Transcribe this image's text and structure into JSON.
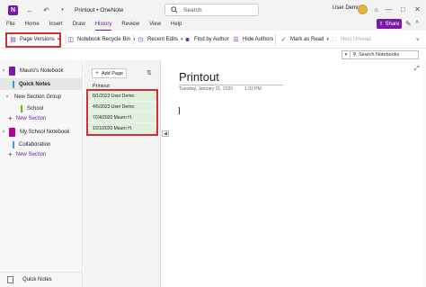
{
  "titlebar": {
    "app_icon": "N",
    "title": "Printout • OneNote",
    "search_placeholder": "Search",
    "user_name": "User Demo",
    "icons": [
      "back-icon",
      "undo-icon",
      "search-icon",
      "lightbulb-icon",
      "minimize-icon",
      "maximize-icon",
      "close-icon"
    ]
  },
  "ribbon": {
    "tabs": [
      "File",
      "Home",
      "Insert",
      "Draw",
      "History",
      "Review",
      "View",
      "Help"
    ],
    "active_tab": "History",
    "share_label": "Share",
    "commands": {
      "page_versions": "Page Versions",
      "recycle_bin": "Notebook Recycle Bin",
      "recent_edits": "Recent Edits",
      "find_by_author": "Find by Author",
      "hide_authors": "Hide Authors",
      "mark_as_read": "Mark as Read",
      "next_unread": "Next Unread"
    }
  },
  "notebook_search": {
    "label": "Search Notebooks"
  },
  "navigation": {
    "notebooks": [
      {
        "name": "Mauro's Notebook",
        "color": "#7719aa",
        "sections": [
          "Quick Notes"
        ],
        "group": "New Section Group",
        "group_sections": [
          "School"
        ],
        "add_label": "New Section"
      },
      {
        "name": "My School Notebook",
        "color": "#b4009e",
        "sections": [
          "Collaboration"
        ],
        "add_label": "New Section"
      }
    ],
    "bottom_label": "Quick Notes"
  },
  "pages": {
    "add_page": "Add Page",
    "title": "Printout",
    "versions": [
      "8/1/2023 User Demo",
      "4/5/2023 User Demo",
      "7/24/2020 Mauro H.",
      "1/21/2020 Mauro H."
    ]
  },
  "page": {
    "title": "Printout",
    "date": "Tuesday, January 21, 2020",
    "time": "1:32 PM"
  },
  "colors": {
    "accent": "#7719aa",
    "highlight": "#d32f2f",
    "version_bg": "#dff0dc",
    "section_quick_notes": "#3a96dd",
    "section_school": "#6bb700",
    "section_collaboration": "#3a96dd"
  }
}
